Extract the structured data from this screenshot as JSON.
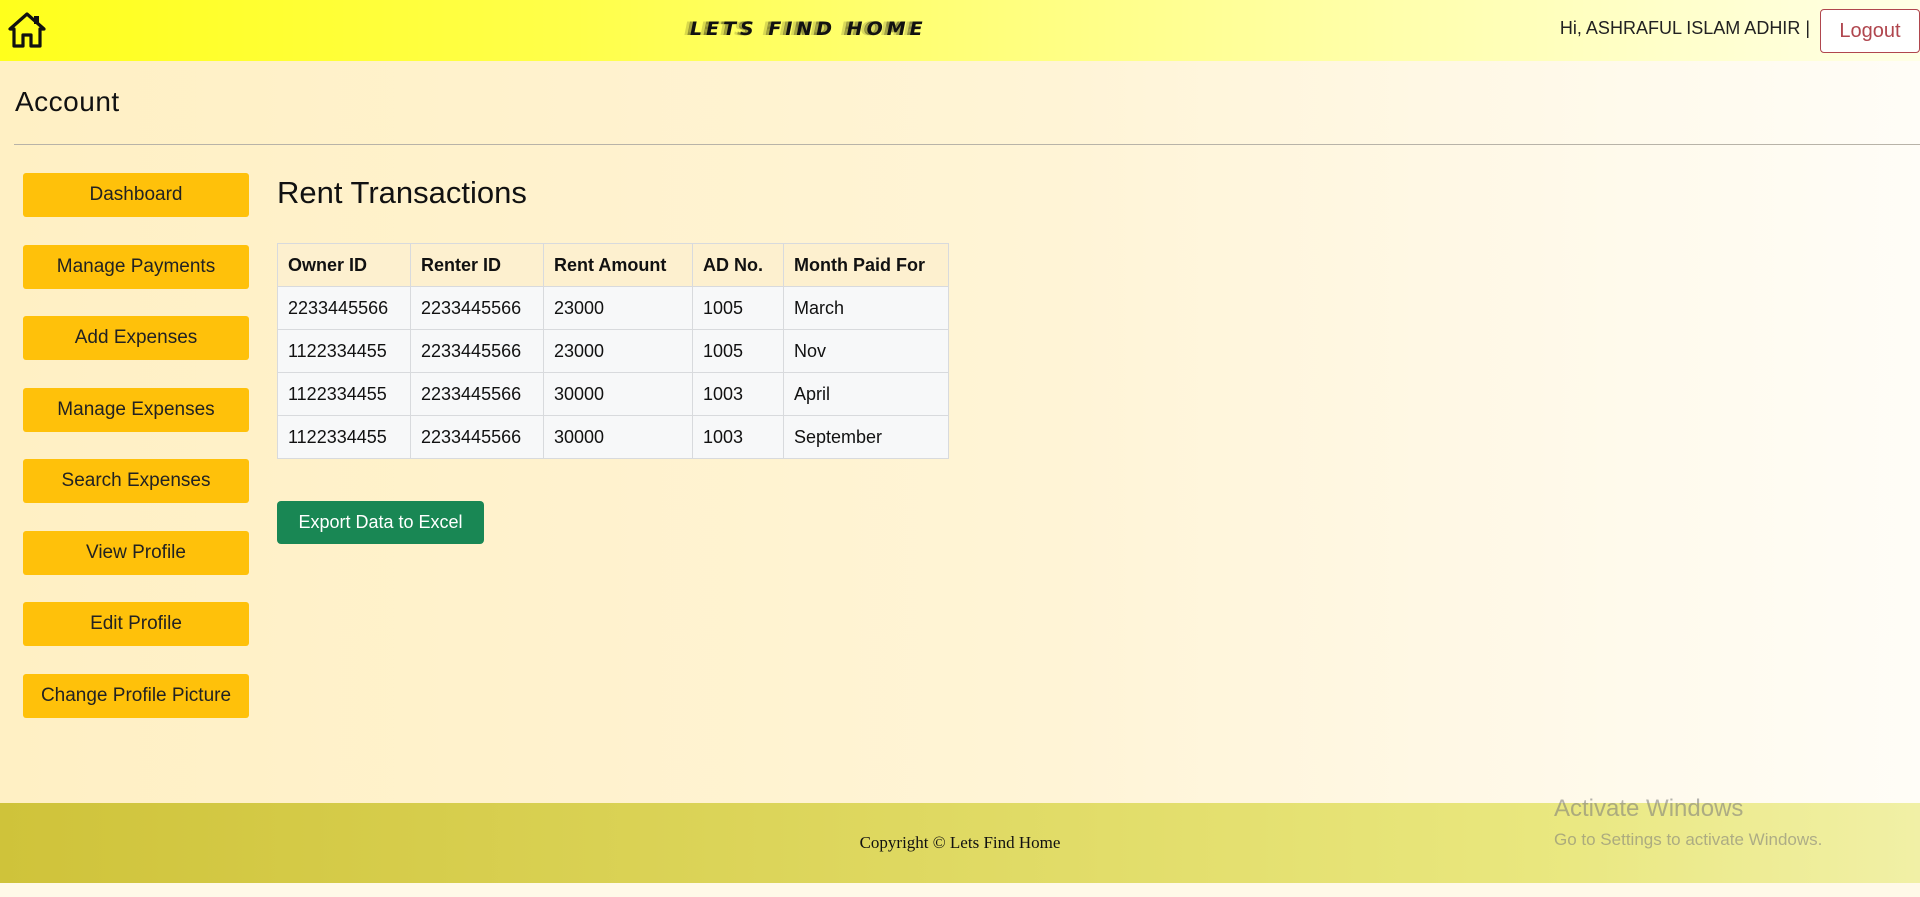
{
  "header": {
    "home_icon": "home-icon",
    "brand": "LETS FIND HOME",
    "greeting": "Hi, ASHRAFUL ISLAM ADHIR |",
    "logout_label": "Logout"
  },
  "page": {
    "title": "Account"
  },
  "sidebar": {
    "items": [
      {
        "label": "Dashboard"
      },
      {
        "label": "Manage Payments"
      },
      {
        "label": "Add Expenses"
      },
      {
        "label": "Manage Expenses"
      },
      {
        "label": "Search Expenses"
      },
      {
        "label": "View Profile"
      },
      {
        "label": "Edit Profile"
      },
      {
        "label": "Change Profile Picture"
      }
    ]
  },
  "main": {
    "section_title": "Rent Transactions",
    "table": {
      "columns": [
        "Owner ID",
        "Renter ID",
        "Rent Amount",
        "AD No.",
        "Month Paid For"
      ],
      "rows": [
        [
          "2233445566",
          "2233445566",
          "23000",
          "1005",
          "March"
        ],
        [
          "1122334455",
          "2233445566",
          "23000",
          "1005",
          "Nov"
        ],
        [
          "1122334455",
          "2233445566",
          "30000",
          "1003",
          "April"
        ],
        [
          "1122334455",
          "2233445566",
          "30000",
          "1003",
          "September"
        ]
      ]
    },
    "export_label": "Export Data to Excel"
  },
  "footer": {
    "copyright": "Copyright © Lets Find Home"
  },
  "watermark": {
    "title": "Activate Windows",
    "subtitle": "Go to Settings to activate Windows."
  },
  "colors": {
    "accent": "#ffc10a",
    "export_button": "#198754",
    "logout": "#b0464e"
  }
}
